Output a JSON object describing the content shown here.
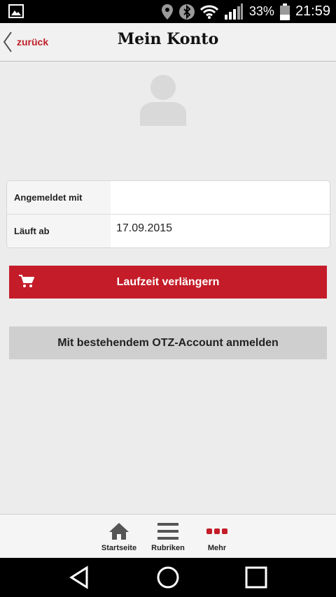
{
  "status_bar": {
    "battery": "33%",
    "time": "21:59"
  },
  "header": {
    "back_label": "zurück",
    "title": "Mein Konto"
  },
  "account": {
    "rows": [
      {
        "label": "Angemeldet mit",
        "value": ""
      },
      {
        "label": "Läuft ab",
        "value": "17.09.2015"
      }
    ]
  },
  "buttons": {
    "extend_label": "Laufzeit verlängern",
    "login_label": "Mit bestehendem OTZ-Account anmelden"
  },
  "tabs": [
    {
      "label": "Startseite",
      "icon": "home-icon"
    },
    {
      "label": "Rubriken",
      "icon": "menu-icon"
    },
    {
      "label": "Mehr",
      "icon": "more-icon"
    }
  ],
  "colors": {
    "accent": "#c41c28",
    "background": "#ececec",
    "secondary_button": "#cfcfcf"
  }
}
